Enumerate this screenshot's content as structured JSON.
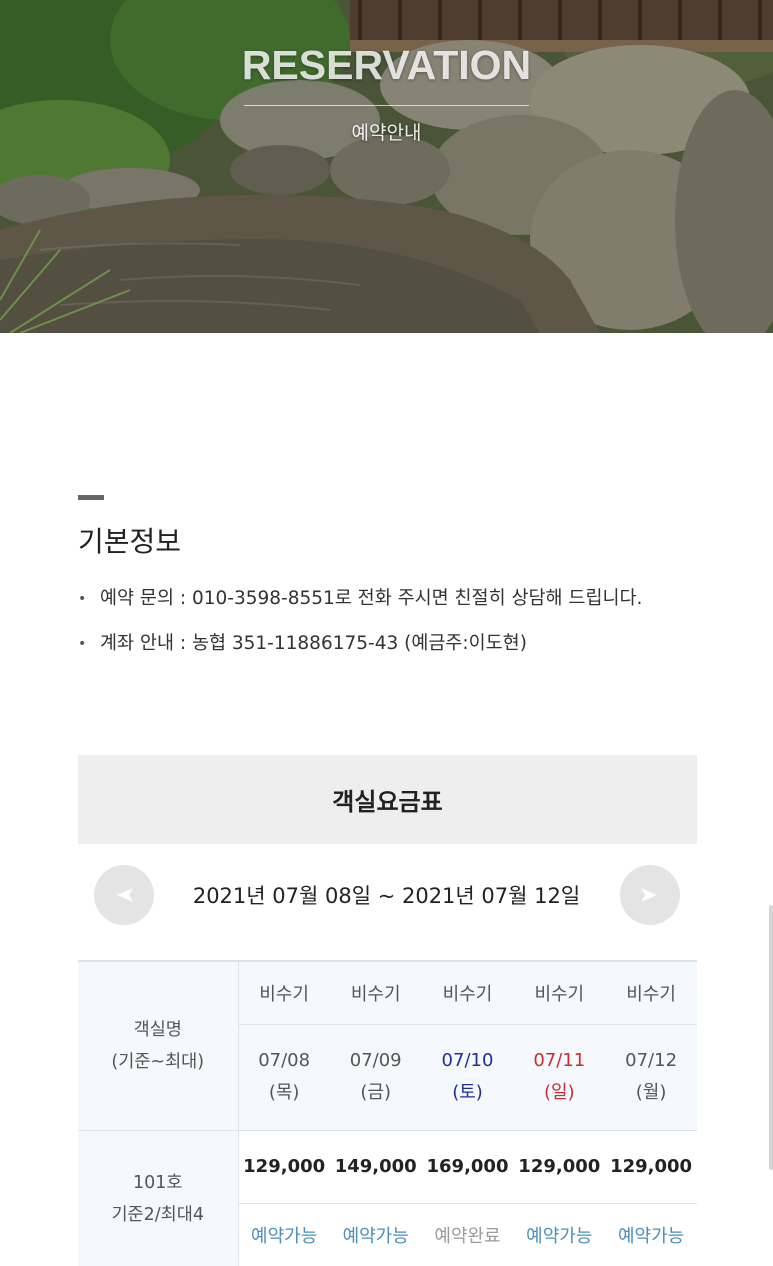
{
  "hero": {
    "title": "RESERVATION",
    "subtitle": "예약안내"
  },
  "section": {
    "title": "기본정보"
  },
  "info": [
    {
      "bullet": "•",
      "text": "예약 문의 : 010-3598-8551로 전화 주시면 친절히 상담해 드립니다."
    },
    {
      "bullet": "•",
      "text": "계좌 안내 : 농협 351-11886175-43 (예금주:이도현)"
    }
  ],
  "rate_table": {
    "title": "객실요금표",
    "date_range": "2021년 07월 08일 ~ 2021년 07월 12일",
    "prev_icon": "chevron-left-icon",
    "next_icon": "chevron-right-icon",
    "room_header_line1": "객실명",
    "room_header_line2": "(기준~최대)",
    "days": [
      {
        "season": "비수기",
        "date": "07/08",
        "weekday": "(목)",
        "color": "#555555"
      },
      {
        "season": "비수기",
        "date": "07/09",
        "weekday": "(금)",
        "color": "#555555"
      },
      {
        "season": "비수기",
        "date": "07/10",
        "weekday": "(토)",
        "color": "#1f2f8f"
      },
      {
        "season": "비수기",
        "date": "07/11",
        "weekday": "(일)",
        "color": "#c92f2f"
      },
      {
        "season": "비수기",
        "date": "07/12",
        "weekday": "(월)",
        "color": "#555555"
      }
    ],
    "rooms": [
      {
        "name": "101호",
        "capacity": "기준2/최대4",
        "prices": [
          "129,000",
          "149,000",
          "169,000",
          "129,000",
          "129,000"
        ],
        "statuses": [
          "예약가능",
          "예약가능",
          "예약완료",
          "예약가능",
          "예약가능"
        ]
      }
    ],
    "status_colors": {
      "available": "#4b8fb8",
      "booked": "#9a9a9a"
    }
  }
}
